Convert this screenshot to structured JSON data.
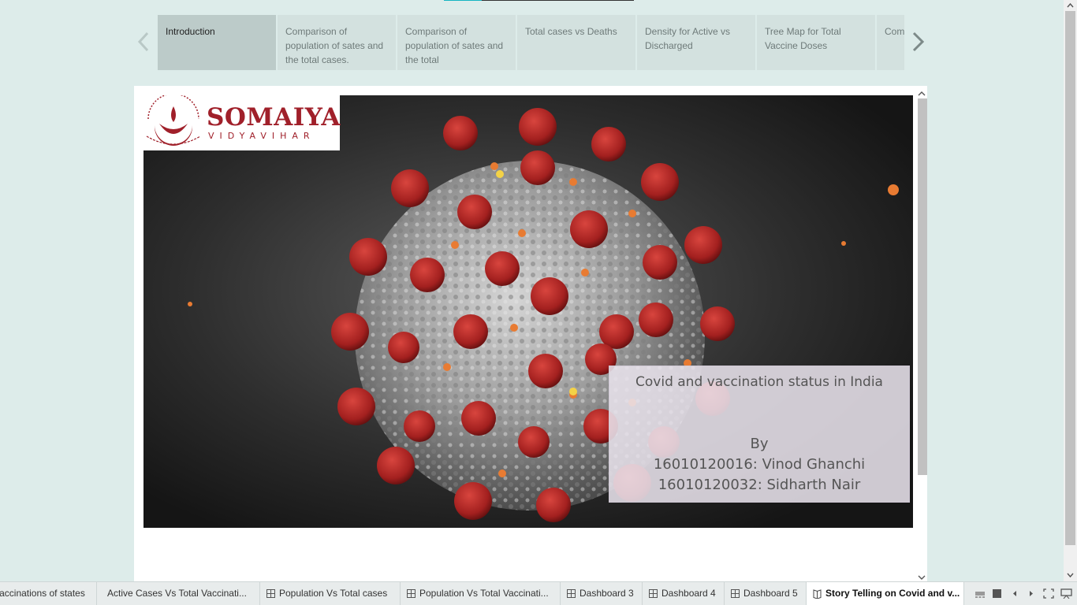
{
  "story_nav": {
    "tabs": [
      {
        "label": "Introduction",
        "active": true
      },
      {
        "label": "Comparison of population of sates and the total cases."
      },
      {
        "label": "Comparison of population of sates and the total"
      },
      {
        "label": "Total cases vs Deaths"
      },
      {
        "label": "Density for Active vs Discharged"
      },
      {
        "label": "Tree Map for Total Vaccine Doses"
      },
      {
        "label": "Com ratio"
      }
    ]
  },
  "dashboard": {
    "logo": {
      "word": "SOMAIYA",
      "sub": "VIDYAVIHAR",
      "seal_text": "Knowledge Alone Liberates · Somaiya Vidyavihar"
    },
    "title_box": {
      "title": "Covid and vaccination status in India",
      "by": "By",
      "author1": "16010120016: Vinod Ghanchi",
      "author2": "16010120032: Sidharth Nair"
    }
  },
  "sheet_tabs": [
    {
      "label": "Vaccinations of states"
    },
    {
      "label": "Active Cases Vs Total Vaccinati..."
    },
    {
      "label": "Population Vs Total cases",
      "icon": "grid-icon"
    },
    {
      "label": "Population Vs Total Vaccinati...",
      "icon": "grid-icon"
    },
    {
      "label": "Dashboard 3",
      "icon": "grid-icon"
    },
    {
      "label": "Dashboard 4",
      "icon": "grid-icon"
    },
    {
      "label": "Dashboard 5",
      "icon": "grid-icon"
    },
    {
      "label": "Story Telling on Covid and v...",
      "icon": "book-icon",
      "active": true
    }
  ],
  "colors": {
    "virus_red": "#a3201f",
    "virus_grey": "#9a9a9a",
    "brand": "#a0202a",
    "accent": "#15b5c2"
  }
}
